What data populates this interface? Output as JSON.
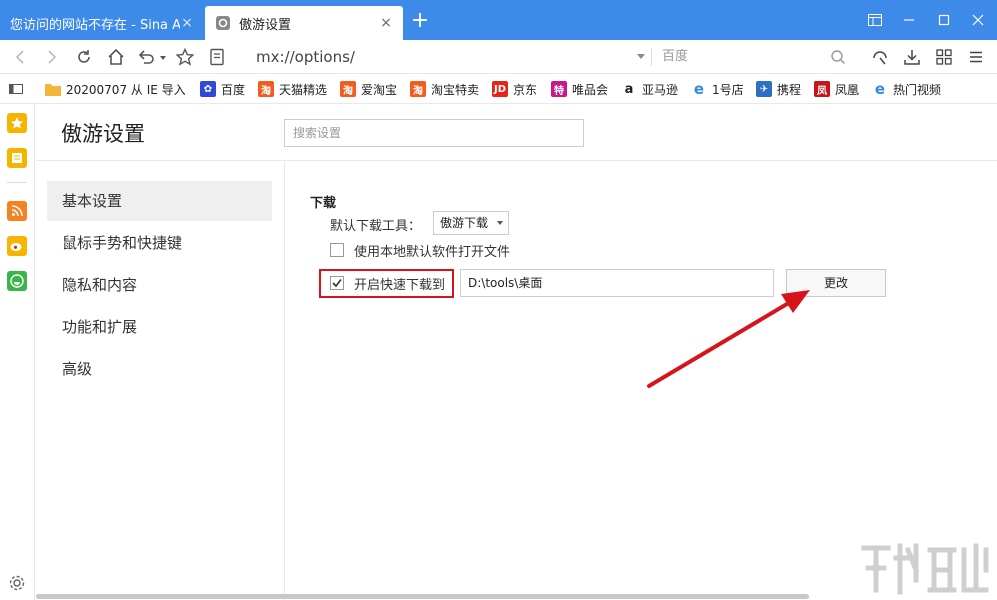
{
  "tabs": [
    {
      "title": "您访问的网站不存在 - Sina A",
      "close": "×"
    },
    {
      "title": "傲游设置",
      "close": "×"
    }
  ],
  "new_tab": "+",
  "address": {
    "url": "mx://options/"
  },
  "search_box": {
    "placeholder": "百度"
  },
  "bookmarks": [
    {
      "label": "20200707 从 IE 导入",
      "icon": "folder-icon",
      "color": "#f3b63a"
    },
    {
      "label": "百度",
      "icon": "baidu-icon",
      "color": "#2f4bd6"
    },
    {
      "label": "天猫精选",
      "icon": "taobao-icon",
      "color": "#f25c1e"
    },
    {
      "label": "爱淘宝",
      "icon": "taobao-icon",
      "color": "#f25c1e"
    },
    {
      "label": "淘宝特卖",
      "icon": "taobao-icon",
      "color": "#f25c1e"
    },
    {
      "label": "京东",
      "icon": "jd-icon",
      "color": "#e1251b"
    },
    {
      "label": "唯品会",
      "icon": "vip-icon",
      "color": "#c8198c"
    },
    {
      "label": "亚马逊",
      "icon": "amazon-icon",
      "color": "#222222"
    },
    {
      "label": "1号店",
      "icon": "ie-icon",
      "color": "#2f8be6"
    },
    {
      "label": "携程",
      "icon": "ctrip-icon",
      "color": "#2c6fc4"
    },
    {
      "label": "凤凰",
      "icon": "ifeng-icon",
      "color": "#c5161d"
    },
    {
      "label": "热门视频",
      "icon": "ie-icon",
      "color": "#2f8be6"
    }
  ],
  "settings": {
    "title": "傲游设置",
    "search_placeholder": "搜索设置",
    "nav": [
      "基本设置",
      "鼠标手势和快捷键",
      "隐私和内容",
      "功能和扩展",
      "高级"
    ],
    "download": {
      "section_title": "下载",
      "tool_label": "默认下载工具：",
      "tool_value": "傲游下载",
      "open_with_local_label": "使用本地默认软件打开文件",
      "open_with_local_checked": false,
      "quick_download_label": "开启快速下载到",
      "quick_download_checked": true,
      "path": "D:\\tools\\桌面",
      "change_label": "更改"
    }
  },
  "colors": {
    "titlebar": "#3d8ae8",
    "highlight": "#d8141b",
    "arrow": "#d8141b"
  }
}
